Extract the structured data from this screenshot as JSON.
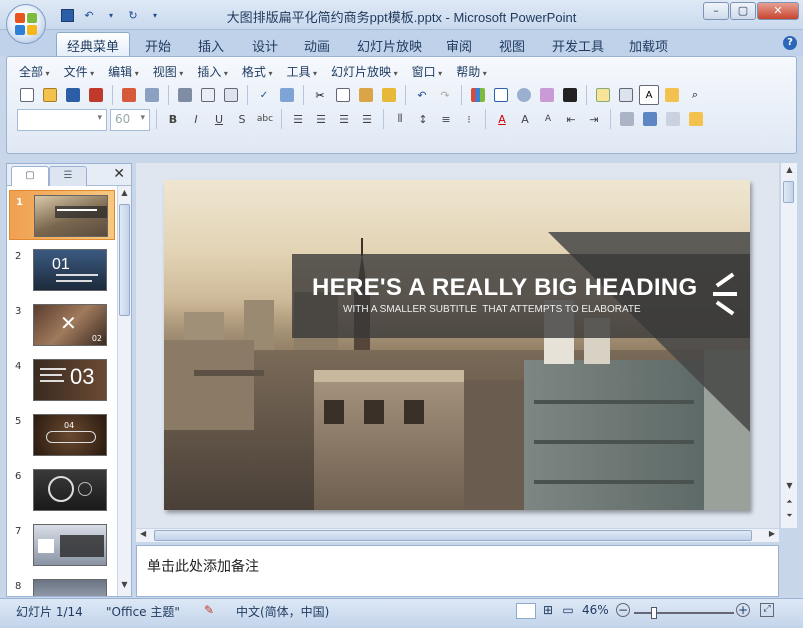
{
  "window": {
    "title": "大图排版扁平化简约商务ppt模板.pptx - Microsoft PowerPoint",
    "minimize": "–",
    "maximize": "▢",
    "close": "✕"
  },
  "tabs": [
    "经典菜单",
    "开始",
    "插入",
    "设计",
    "动画",
    "幻灯片放映",
    "审阅",
    "视图",
    "开发工具",
    "加载项"
  ],
  "active_tab": "经典菜单",
  "classic_menus": [
    "全部",
    "文件",
    "编辑",
    "视图",
    "插入",
    "格式",
    "工具",
    "幻灯片放映",
    "窗口",
    "帮助"
  ],
  "font_size_value": "60",
  "panel": {
    "close": "✕",
    "slides": [
      {
        "number": "1",
        "label": ""
      },
      {
        "number": "2",
        "label": "01"
      },
      {
        "number": "3",
        "label": "02"
      },
      {
        "number": "4",
        "label": "03"
      },
      {
        "number": "5",
        "label": "04"
      },
      {
        "number": "6",
        "label": ""
      },
      {
        "number": "7",
        "label": ""
      },
      {
        "number": "8",
        "label": ""
      }
    ]
  },
  "slide": {
    "heading": "HERE'S A REALLY BIG HEADING",
    "subtitle": "WITH A SMALLER SUBTITLE  THAT ATTEMPTS TO ELABORATE"
  },
  "notes_placeholder": "单击此处添加备注",
  "status": {
    "slide_indicator": "幻灯片 1/14",
    "theme": "\"Office 主题\"",
    "language": "中文(简体，中国)",
    "zoom": "46%",
    "zoom_fraction": 0.46
  }
}
